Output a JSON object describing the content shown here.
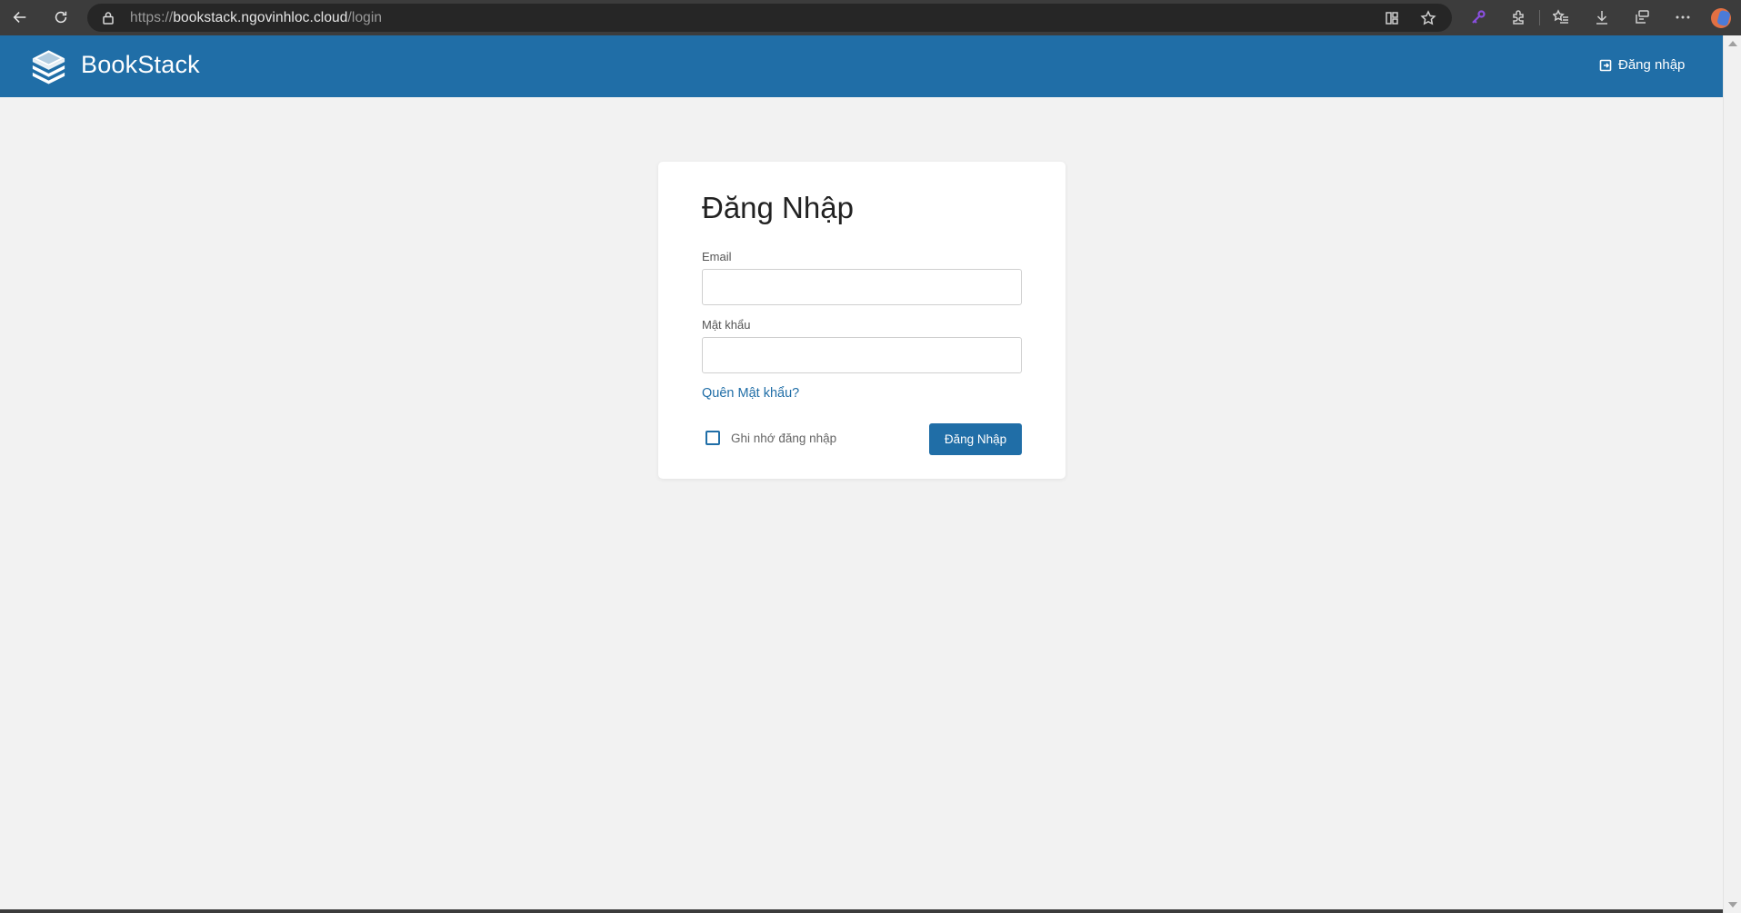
{
  "browser": {
    "url_scheme": "https://",
    "url_host": "bookstack.ngovinhloc.cloud",
    "url_path": "/login"
  },
  "icons": {
    "back": "back-arrow-icon",
    "reload": "reload-icon",
    "lock": "lock-icon",
    "split_view": "split-screen-icon",
    "favorite": "star-icon",
    "password": "key-icon",
    "extensions": "puzzle-icon",
    "favorites": "favorites-list-icon",
    "downloads": "download-icon",
    "collections": "collections-icon",
    "more": "more-dots-icon",
    "profile": "profile-avatar",
    "logo": "bookstack-logo-icon",
    "login": "login-arrow-icon"
  },
  "header": {
    "brand": "BookStack",
    "login_link": "Đăng nhập"
  },
  "login": {
    "title": "Đăng Nhập",
    "email_label": "Email",
    "email_value": "",
    "password_label": "Mật khẩu",
    "password_value": "",
    "forgot_link": "Quên Mật khẩu?",
    "remember_label": "Ghi nhớ đăng nhập",
    "remember_checked": false,
    "submit_label": "Đăng Nhập"
  },
  "colors": {
    "primary": "#206ea7",
    "background": "#f2f2f2",
    "browser_chrome": "#3c3c3c"
  }
}
